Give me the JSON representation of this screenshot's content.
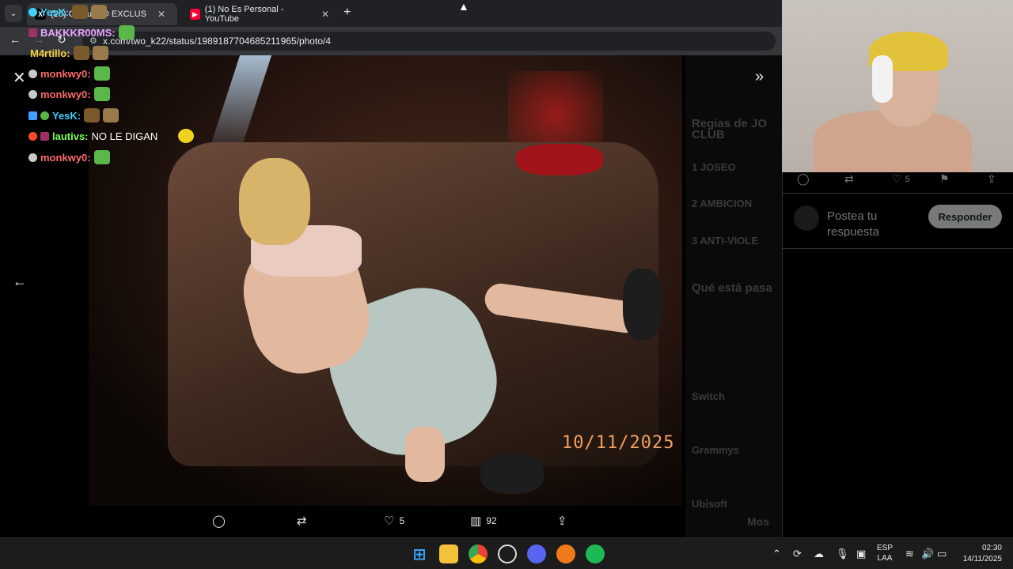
{
  "browser": {
    "tabs": [
      {
        "label": "(20) Comu",
        "label_overflow": "EO EXCLUS",
        "favicon": "x-logo",
        "active": true
      },
      {
        "label": "(1) No Es Personal - YouTube",
        "favicon": "youtube-logo",
        "active": false
      }
    ],
    "url": "x.com/two_k22/status/1989187704685211965/photo/4"
  },
  "chat": [
    {
      "user": "YesK:",
      "user_color": "#3ed0ff",
      "message": "",
      "emote_colors": [
        "#7a5a2a",
        "#9a7a4a"
      ]
    },
    {
      "user": "BAKKKR00MS:",
      "user_color": "#e8a6ff",
      "message": "",
      "emote_colors": [
        "#5ab84a"
      ]
    },
    {
      "user": "M4rtillo:",
      "user_color": "#f5d142",
      "message": "",
      "emote_colors": [
        "#7a5a2a",
        "#9a7a4a"
      ]
    },
    {
      "user": "monkwy0:",
      "user_color": "#ff6a6a",
      "message": "",
      "emote_colors": [
        "#5ab84a"
      ]
    },
    {
      "user": "monkwy0:",
      "user_color": "#ff6a6a",
      "message": "",
      "emote_colors": [
        "#5ab84a"
      ]
    },
    {
      "user": "YesK:",
      "user_color": "#3ed0ff",
      "message": "",
      "emote_colors": [
        "#7a5a2a",
        "#9a7a4a"
      ]
    },
    {
      "user": "lautivs:",
      "user_color": "#7cff5a",
      "message": "NO LE DIGAN",
      "emote_colors": [
        "#f0d020"
      ]
    },
    {
      "user": "monkwy0:",
      "user_color": "#ff6a6a",
      "message": "",
      "emote_colors": [
        "#5ab84a"
      ]
    }
  ],
  "photo": {
    "date_stamp": "10/11/2025"
  },
  "side_dimmed": {
    "heading": "Regias de JO",
    "heading2": "CLUB",
    "rules": [
      "1  JOSEO",
      "2  AMBICION",
      "3  ANTI-VIOLE"
    ],
    "trending_title": "Qué está pasa",
    "items": [
      "Switch",
      "Grammys",
      "Ubisoft"
    ],
    "more": "Mos"
  },
  "actions": {
    "likes": "5",
    "views": "92"
  },
  "right_panel": {
    "likes": "5",
    "reply_placeholder": "Postea tu respuesta",
    "reply_button": "Responder"
  },
  "taskbar": {
    "lang_line1": "ESP",
    "lang_line2": "LAA",
    "time": "02:30",
    "date": "14/11/2025"
  },
  "colors": {
    "accent_blue": "#1d9bf0",
    "reply_button_bg": "#787a7a",
    "tab_bg": "#202124"
  }
}
